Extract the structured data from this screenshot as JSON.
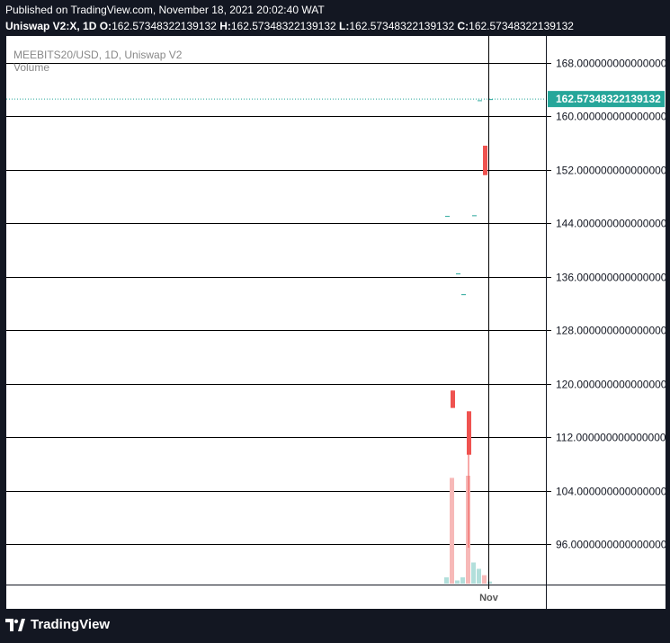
{
  "header": {
    "published": "Published on TradingView.com, November 18, 2021 20:02:40 WAT",
    "symbol": "Uniswap V2:X, 1D",
    "o_label": "O:",
    "o_value": "162.57348322139132",
    "h_label": "H:",
    "h_value": "162.57348322139132",
    "l_label": "L:",
    "l_value": "162.57348322139132",
    "c_label": "C:",
    "c_value": "162.57348322139132"
  },
  "legend": {
    "pair": "MEEBITS20/USD, 1D, Uniswap V2",
    "volume": "Volume"
  },
  "brand": {
    "name": "TradingView"
  },
  "colors": {
    "up": "#26a69a",
    "down": "#ef5350",
    "vol_up": "#b2dfdb",
    "vol_down": "#f7b9b8",
    "price_line": "#26a69a"
  },
  "chart_data": {
    "type": "candlestick",
    "y_ticks": [
      "168.0000000000000000",
      "160.0000000000000000",
      "152.0000000000000000",
      "144.0000000000000000",
      "136.0000000000000000",
      "128.0000000000000000",
      "120.0000000000000000",
      "112.0000000000000000",
      "104.0000000000000000",
      "96.0000000000000000"
    ],
    "y_tick_values": [
      168,
      160,
      152,
      144,
      136,
      128,
      120,
      112,
      104,
      96
    ],
    "ylim": [
      90,
      172
    ],
    "x_ticks": [
      "Nov"
    ],
    "last_price": 162.5734832213913,
    "last_price_label": "162.57348322139132",
    "candles": [
      {
        "o": 145.1,
        "h": 145.1,
        "l": 145.1,
        "c": 145.1,
        "vol": 6,
        "dir": "up"
      },
      {
        "o": 119.0,
        "h": 119.0,
        "l": 116.4,
        "c": 116.4,
        "vol": 100,
        "dir": "down"
      },
      {
        "o": 136.5,
        "h": 136.5,
        "l": 136.5,
        "c": 136.5,
        "vol": 3,
        "dir": "up"
      },
      {
        "o": 133.4,
        "h": 133.4,
        "l": 133.4,
        "c": 133.4,
        "vol": 6,
        "dir": "up"
      },
      {
        "o": 115.9,
        "h": 115.9,
        "l": 95.5,
        "c": 109.4,
        "vol": 102,
        "dir": "down"
      },
      {
        "o": 145.2,
        "h": 145.2,
        "l": 145.2,
        "c": 145.2,
        "vol": 20,
        "dir": "up"
      },
      {
        "o": 162.4,
        "h": 162.4,
        "l": 162.4,
        "c": 162.4,
        "vol": 14,
        "dir": "up"
      },
      {
        "o": 155.6,
        "h": 155.6,
        "l": 151.2,
        "c": 151.2,
        "vol": 8,
        "dir": "down"
      },
      {
        "o": 162.57,
        "h": 162.57,
        "l": 162.57,
        "c": 162.57,
        "vol": 2,
        "dir": "up"
      }
    ]
  }
}
